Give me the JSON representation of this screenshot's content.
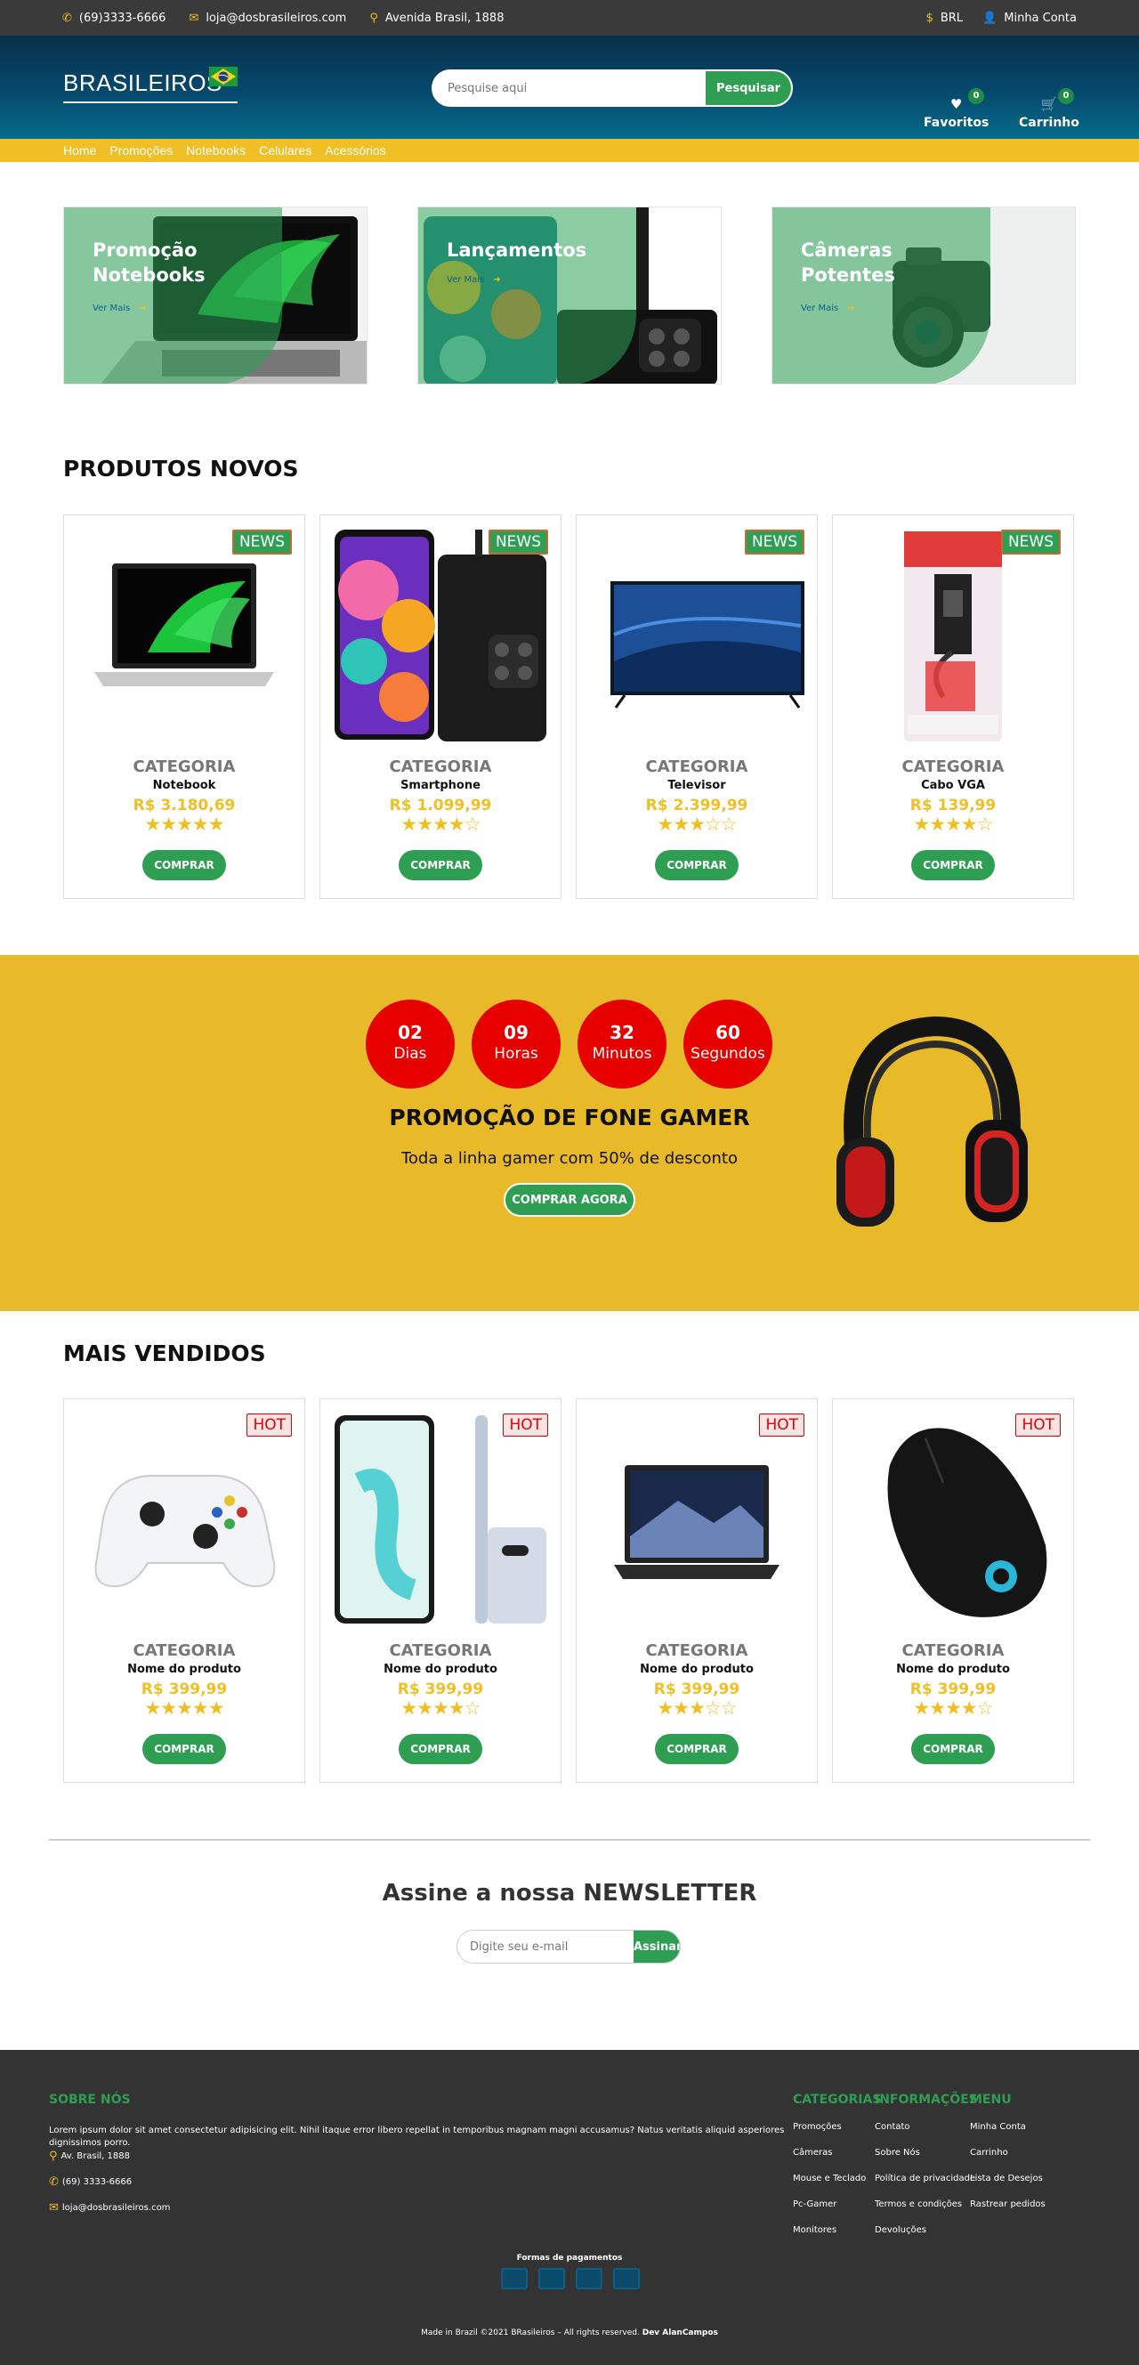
{
  "topbar": {
    "phone": "(69)3333-6666",
    "email": "loja@dosbrasileiros.com",
    "address": "Avenida Brasil, 1888",
    "currency": "BRL",
    "account": "Minha Conta"
  },
  "header": {
    "logo_text": "BRASILEIROS",
    "search_placeholder": "Pesquise aqui",
    "search_button": "Pesquisar",
    "favorites_label": "Favoritos",
    "favorites_count": "0",
    "cart_label": "Carrinho",
    "cart_count": "0"
  },
  "nav": [
    "Home",
    "Promoções",
    "Notebooks",
    "Celulares",
    "Acessórios"
  ],
  "banners": [
    {
      "title": "Promoção Notebooks",
      "link": "Ver Mais"
    },
    {
      "title": "Lançamentos",
      "link": "Ver Mais"
    },
    {
      "title": "Câmeras Potentes",
      "link": "Ver Mais"
    }
  ],
  "new_products": {
    "title": "PRODUTOS NOVOS",
    "items": [
      {
        "tag": "NEWS",
        "category": "CATEGORIA",
        "name": "Notebook",
        "price": "R$ 3.180,69",
        "rating": 5,
        "button": "COMPRAR"
      },
      {
        "tag": "NEWS",
        "category": "CATEGORIA",
        "name": "Smartphone",
        "price": "R$ 1.099,99",
        "rating": 4,
        "button": "COMPRAR"
      },
      {
        "tag": "NEWS",
        "category": "CATEGORIA",
        "name": "Televisor",
        "price": "R$ 2.399,99",
        "rating": 3,
        "button": "COMPRAR"
      },
      {
        "tag": "NEWS",
        "category": "CATEGORIA",
        "name": "Cabo VGA",
        "price": "R$ 139,99",
        "rating": 4,
        "button": "COMPRAR"
      }
    ]
  },
  "promo": {
    "countdown": [
      {
        "value": "02",
        "label": "Dias"
      },
      {
        "value": "09",
        "label": "Horas"
      },
      {
        "value": "32",
        "label": "Minutos"
      },
      {
        "value": "60",
        "label": "Segundos"
      }
    ],
    "title": "PROMOÇÃO DE FONE GAMER",
    "subtitle": "Toda a linha gamer com 50% de desconto",
    "button": "COMPRAR AGORA"
  },
  "best_sellers": {
    "title": "MAIS VENDIDOS",
    "items": [
      {
        "tag": "HOT",
        "category": "CATEGORIA",
        "name": "Nome do produto",
        "price": "R$ 399,99",
        "rating": 5,
        "button": "COMPRAR"
      },
      {
        "tag": "HOT",
        "category": "CATEGORIA",
        "name": "Nome do produto",
        "price": "R$ 399,99",
        "rating": 4,
        "button": "COMPRAR"
      },
      {
        "tag": "HOT",
        "category": "CATEGORIA",
        "name": "Nome do produto",
        "price": "R$ 399,99",
        "rating": 3,
        "button": "COMPRAR"
      },
      {
        "tag": "HOT",
        "category": "CATEGORIA",
        "name": "Nome do produto",
        "price": "R$ 399,99",
        "rating": 4,
        "button": "COMPRAR"
      }
    ]
  },
  "newsletter": {
    "title": "Assine a nossa NEWSLETTER",
    "placeholder": "Digite seu e-mail",
    "button": "Assinar"
  },
  "footer": {
    "about_title": "SOBRE NÓS",
    "about_text": "Lorem ipsum dolor sit amet consectetur adipisicing elit. Nihil itaque error libero repellat in temporibus magnam magni accusamus? Natus veritatis aliquid asperiores dignissimos porro.",
    "address": "Av. Brasil, 1888",
    "phone": "(69) 3333-6666",
    "email": "loja@dosbrasileiros.com",
    "categories_title": "CATEGORIAS",
    "categories": [
      "Promoções",
      "Câmeras",
      "Mouse e Teclado",
      "Pc-Gamer",
      "Monitores"
    ],
    "info_title": "INFORMAÇÕES",
    "info": [
      "Contato",
      "Sobre Nós",
      "Política de privacidade",
      "Termos e condições",
      "Devoluções"
    ],
    "menu_title": "MENU",
    "menu": [
      "Minha Conta",
      "Carrinho",
      "Lista de Desejos",
      "Rastrear pedidos"
    ],
    "payments_title": "Formas de pagamentos",
    "payment_icons": [
      "visa-icon",
      "mastercard-icon",
      "paypal-icon",
      "pix-icon"
    ],
    "copyright": "Made in Brazil ©2021 BRasileiros – All rights reserved.",
    "author": "Dev AlanCampos"
  },
  "colors": {
    "accent_green": "#2e9e53",
    "accent_yellow": "#f0bf26",
    "promo_red": "#e60000",
    "header_blue": "#05496d"
  }
}
